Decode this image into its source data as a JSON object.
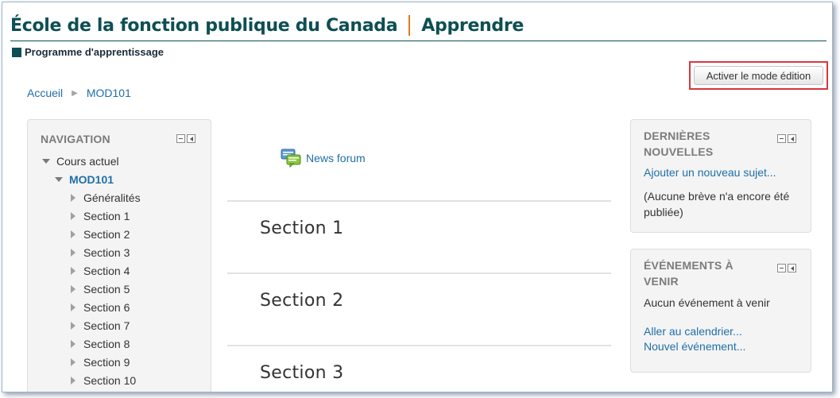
{
  "header": {
    "site_name": "École de la fonction publique du Canada",
    "section_name": "Apprendre",
    "program_label": "Programme d'apprentissage"
  },
  "toolbar": {
    "edit_mode_label": "Activer le mode édition"
  },
  "breadcrumb": {
    "items": [
      "Accueil",
      "MOD101"
    ]
  },
  "navigation": {
    "title": "NAVIGATION",
    "current_course_label": "Cours actuel",
    "course": "MOD101",
    "items": [
      "Généralités",
      "Section 1",
      "Section 2",
      "Section 3",
      "Section 4",
      "Section 5",
      "Section 6",
      "Section 7",
      "Section 8",
      "Section 9",
      "Section 10"
    ]
  },
  "main": {
    "forum_label": "News forum",
    "sections": [
      "Section 1",
      "Section 2",
      "Section 3"
    ]
  },
  "latest_news": {
    "title": "DERNIÈRES NOUVELLES",
    "add_topic_link": "Ajouter un nouveau sujet...",
    "empty_text": "(Aucune brève n'a encore été publiée)"
  },
  "upcoming_events": {
    "title": "ÉVÉNEMENTS À VENIR",
    "empty_text": "Aucun événement à venir",
    "calendar_link": "Aller au calendrier...",
    "new_event_link": "Nouvel événement..."
  },
  "colors": {
    "brand": "#0d4f53",
    "accent": "#e07a1f",
    "link": "#1f6fa8",
    "highlight": "#d9363e"
  }
}
